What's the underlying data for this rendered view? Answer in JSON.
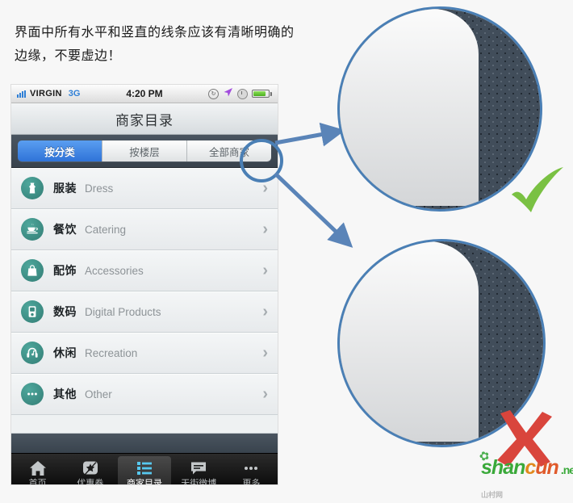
{
  "annotation": {
    "headline": "界面中所有水平和竖直的线条应该有清晰明确的\n边缘，不要虚边！",
    "check_label": "✔",
    "cross_label": "✘"
  },
  "phone": {
    "status_bar": {
      "signal_icon": "signal-bars-icon",
      "carrier": "VIRGIN",
      "network": "3G",
      "time": "4:20 PM",
      "rotation_lock_icon": "rotation-lock-icon",
      "rotation_lock_glyph": "↻",
      "location_icon": "location-arrow-icon",
      "location_glyph": "➤",
      "alarm_icon": "clock-icon",
      "battery_icon": "battery-icon"
    },
    "navbar": {
      "title": "商家目录"
    },
    "segmented": {
      "tabs": [
        {
          "label": "按分类",
          "active": true
        },
        {
          "label": "按楼层",
          "active": false
        },
        {
          "label": "全部商家",
          "active": false
        }
      ]
    },
    "list": {
      "chevron": "›",
      "rows": [
        {
          "icon": "dress-icon",
          "cn": "服装",
          "en": "Dress"
        },
        {
          "icon": "coffee-cup-icon",
          "cn": "餐饮",
          "en": "Catering"
        },
        {
          "icon": "handbag-icon",
          "cn": "配饰",
          "en": "Accessories"
        },
        {
          "icon": "device-icon",
          "cn": "数码",
          "en": "Digital Products"
        },
        {
          "icon": "headphones-icon",
          "cn": "休闲",
          "en": "Recreation"
        },
        {
          "icon": "ellipsis-icon",
          "cn": "其他",
          "en": "Other"
        }
      ]
    },
    "tabbar": {
      "items": [
        {
          "icon": "home-icon",
          "label": "首页",
          "active": false
        },
        {
          "icon": "star-icon",
          "label": "优惠券",
          "active": false
        },
        {
          "icon": "list-icon",
          "label": "商家目录",
          "active": true
        },
        {
          "icon": "chat-icon",
          "label": "天街微博",
          "active": false
        },
        {
          "icon": "ellipsis-icon",
          "label": "更多",
          "active": false
        }
      ]
    }
  },
  "magnifiers": [
    {
      "name": "crisp-edge-example",
      "verdict": "good"
    },
    {
      "name": "soft-edge-example",
      "verdict": "bad"
    }
  ],
  "watermark": {
    "part1": "shan",
    "part2": "c",
    "part3": "un",
    "suffix": ".net",
    "cn": "山村网"
  },
  "colors": {
    "accent_blue": "#2f73d8",
    "annotation_blue": "#4a7fb5",
    "icon_teal": "#3b8a80",
    "check_green": "#7ac143",
    "cross_red": "#d9453c"
  }
}
